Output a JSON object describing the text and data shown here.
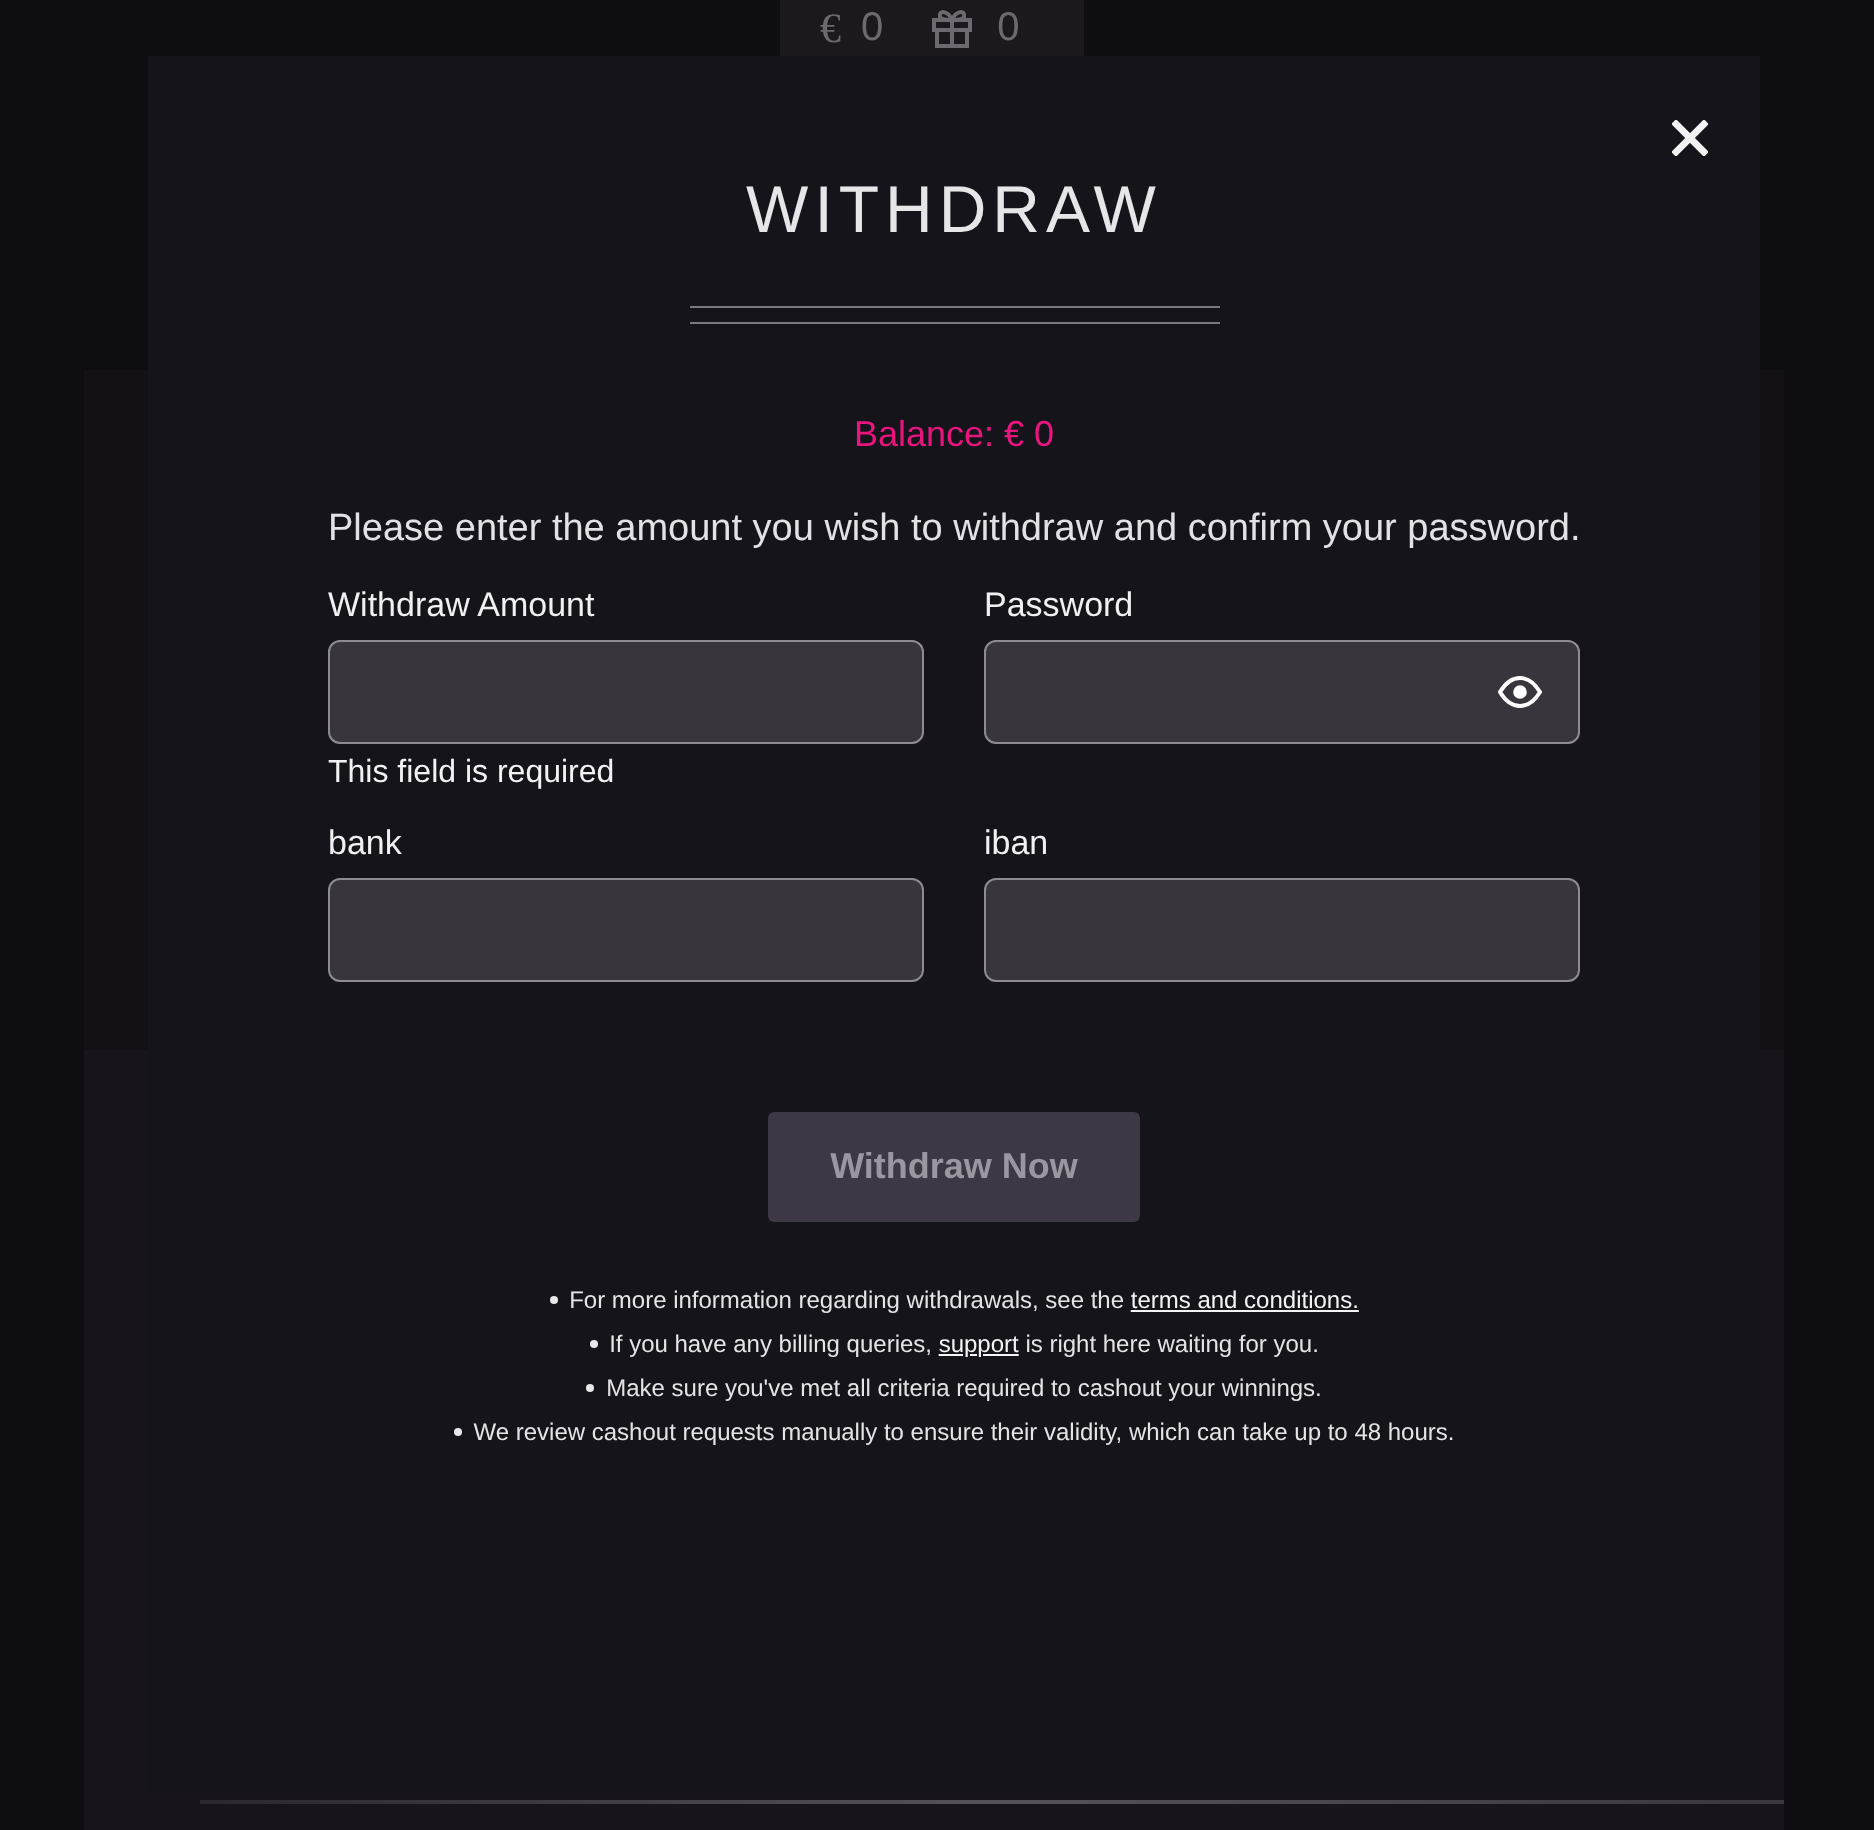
{
  "top_bar": {
    "currency": "€",
    "balance": "0",
    "bonus": "0"
  },
  "modal": {
    "title": "WITHDRAW",
    "balance": "Balance: € 0",
    "instruction": "Please enter the amount you wish to withdraw and confirm your password.",
    "fields": [
      {
        "label": "Withdraw Amount",
        "kind": "text",
        "error": "This field is required"
      },
      {
        "label": "Password",
        "kind": "password"
      },
      {
        "label": "bank",
        "kind": "text"
      },
      {
        "label": "iban",
        "kind": "text"
      }
    ],
    "submit": {
      "label": "Withdraw Now",
      "disabled": true
    },
    "notes": [
      {
        "segments": [
          {
            "kind": "text",
            "text": "For more information regarding withdrawals, see the "
          },
          {
            "kind": "link",
            "text": "terms and conditions."
          }
        ]
      },
      {
        "segments": [
          {
            "kind": "text",
            "text": "If you have any billing queries, "
          },
          {
            "kind": "link",
            "text": "support"
          },
          {
            "kind": "text",
            "text": " is right here waiting for you."
          }
        ]
      },
      {
        "segments": [
          {
            "kind": "text",
            "text": "Make sure you've met all criteria required to cashout your winnings."
          }
        ]
      },
      {
        "segments": [
          {
            "kind": "text",
            "text": "We review cashout requests manually to ensure their validity, which can take up to 48 hours."
          }
        ]
      }
    ]
  }
}
